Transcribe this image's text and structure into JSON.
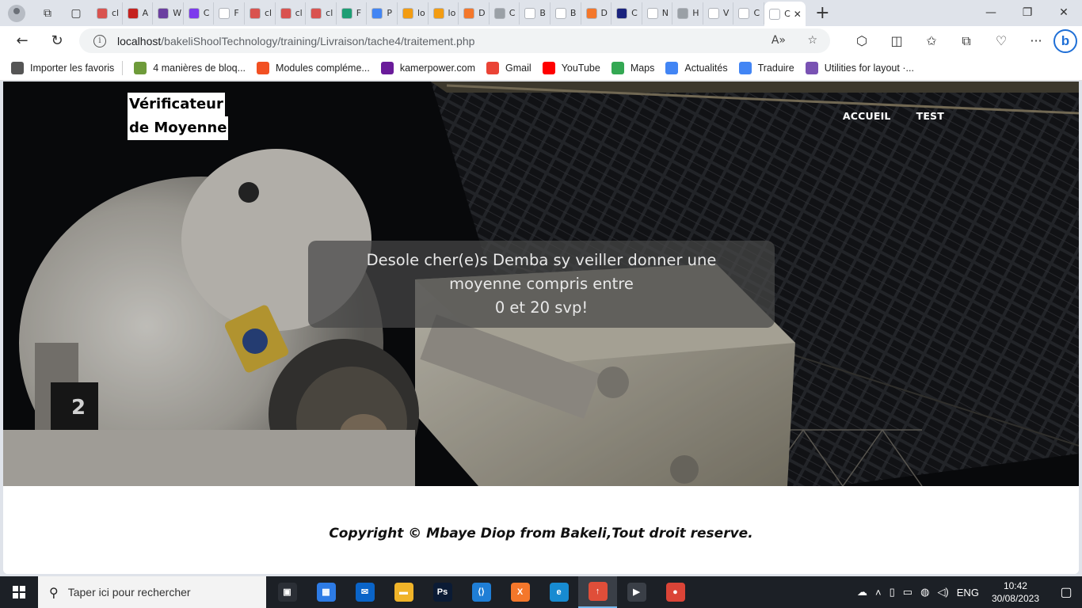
{
  "browser": {
    "tabs": [
      {
        "label": "cl",
        "color": "#d9534f"
      },
      {
        "label": "A",
        "color": "#c5221f"
      },
      {
        "label": "W",
        "color": "#6b3fa0"
      },
      {
        "label": "C",
        "color": "#7c3aed"
      },
      {
        "label": "F",
        "color": "#ffffff"
      },
      {
        "label": "cl",
        "color": "#d9534f"
      },
      {
        "label": "cl",
        "color": "#d9534f"
      },
      {
        "label": "cl",
        "color": "#d9534f"
      },
      {
        "label": "F",
        "color": "#1d9e74"
      },
      {
        "label": "P",
        "color": "#4285f4"
      },
      {
        "label": "lo",
        "color": "#f39c12"
      },
      {
        "label": "lo",
        "color": "#f39c12"
      },
      {
        "label": "D",
        "color": "#f4772b"
      },
      {
        "label": "C",
        "color": "#9aa0a6"
      },
      {
        "label": "B",
        "color": "#ffffff"
      },
      {
        "label": "B",
        "color": "#ffffff"
      },
      {
        "label": "D",
        "color": "#f4772b"
      },
      {
        "label": "C",
        "color": "#1a237e"
      },
      {
        "label": "N",
        "color": "#ffffff"
      },
      {
        "label": "H",
        "color": "#9aa0a6"
      },
      {
        "label": "V",
        "color": "#ffffff"
      },
      {
        "label": "C",
        "color": "#ffffff"
      }
    ],
    "active_tab_label": "C",
    "url_host": "localhost",
    "url_path": "/bakeliShoolTechnology/training/Livraison/tache4/traitement.php",
    "favorites": [
      {
        "label": "Importer les favoris",
        "color": "#555555"
      },
      {
        "label": "4 manières de bloq...",
        "color": "#6e9b3a"
      },
      {
        "label": "Modules compléme...",
        "color": "#f25022"
      },
      {
        "label": "kamerpower.com",
        "color": "#6a1b9a"
      },
      {
        "label": "Gmail",
        "color": "#ea4335"
      },
      {
        "label": "YouTube",
        "color": "#ff0000"
      },
      {
        "label": "Maps",
        "color": "#34a853"
      },
      {
        "label": "Actualités",
        "color": "#4285f4"
      },
      {
        "label": "Traduire",
        "color": "#4285f4"
      },
      {
        "label": "Utilities for layout ·...",
        "color": "#7952b3"
      }
    ]
  },
  "page": {
    "brand_line1": "Vérificateur",
    "brand_line2": "de Moyenne",
    "nav": [
      "ACCUEIL",
      "TEST"
    ],
    "message_line1": "Desole cher(e)s Demba sy veiller donner une moyenne compris entre",
    "message_line2": "0 et 20 svp!",
    "footer": "Copyright © Mbaye Diop from Bakeli,Tout droit reserve."
  },
  "taskbar": {
    "search_placeholder": "Taper ici pour rechercher",
    "apps": [
      {
        "name": "task-view",
        "label": "▣",
        "color": "#2b2f36"
      },
      {
        "name": "store",
        "label": "▦",
        "color": "#2d7be5"
      },
      {
        "name": "mail",
        "label": "✉",
        "color": "#0a64c8"
      },
      {
        "name": "explorer",
        "label": "▬",
        "color": "#f0b429"
      },
      {
        "name": "photoshop",
        "label": "Ps",
        "color": "#0b1b35"
      },
      {
        "name": "vscode",
        "label": "⟨⟩",
        "color": "#1f7ed6"
      },
      {
        "name": "xampp",
        "label": "X",
        "color": "#f4772b"
      },
      {
        "name": "edge",
        "label": "e",
        "color": "#178bd1"
      },
      {
        "name": "git",
        "label": "↑",
        "color": "#e04e39"
      },
      {
        "name": "media",
        "label": "▶",
        "color": "#3a3f47"
      },
      {
        "name": "chrome",
        "label": "●",
        "color": "#db4437"
      }
    ],
    "language": "ENG",
    "time": "10:42",
    "date": "30/08/2023"
  }
}
